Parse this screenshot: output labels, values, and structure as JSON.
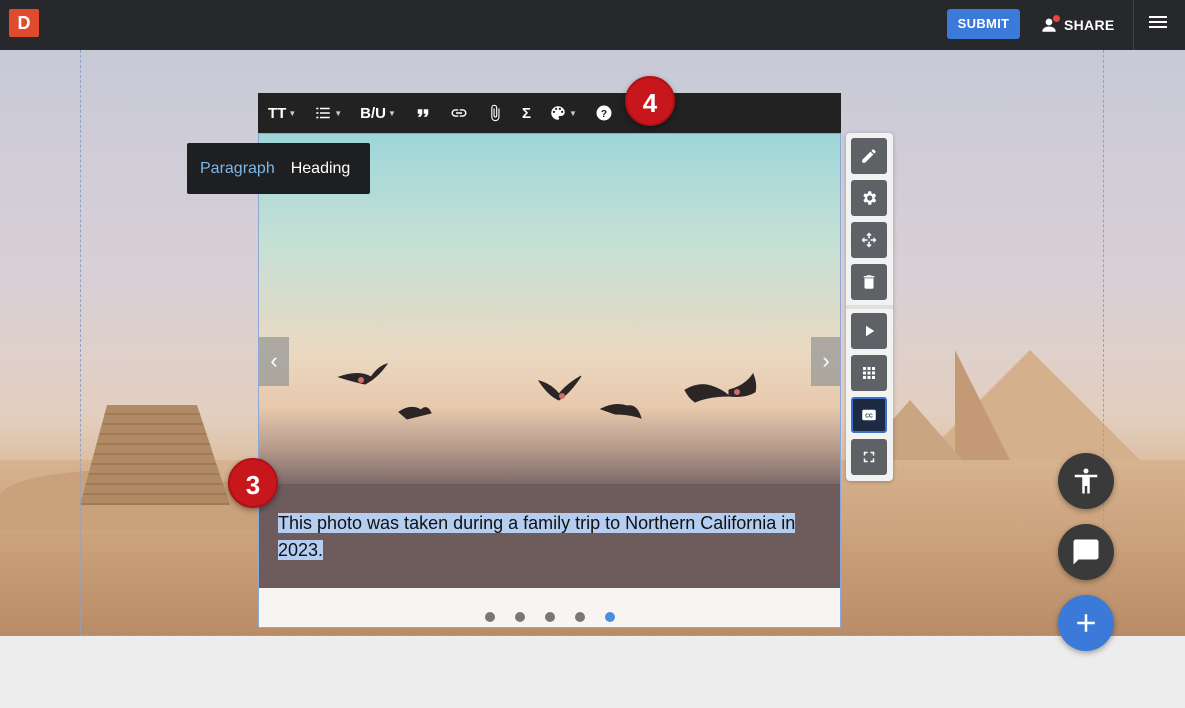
{
  "app": {
    "logo_letter": "D"
  },
  "header": {
    "submit_label": "SUBMIT",
    "share_label": "SHARE"
  },
  "toolbar": {
    "items": [
      {
        "label": "TT",
        "icon": "text-size-icon"
      },
      {
        "icon": "list-icon"
      },
      {
        "label": "B/U",
        "icon": "bold-underline-icon"
      },
      {
        "icon": "quote-icon"
      },
      {
        "icon": "link-icon"
      },
      {
        "icon": "attachment-icon"
      },
      {
        "label": "Σ",
        "icon": "math-icon"
      },
      {
        "icon": "palette-icon"
      },
      {
        "icon": "help-icon"
      }
    ]
  },
  "text_style_popover": {
    "paragraph": "Paragraph",
    "heading": "Heading"
  },
  "step_badges": {
    "top": "4",
    "caption": "3"
  },
  "slideshow": {
    "caption": "This photo was taken during a family trip to Northern California in 2023.",
    "slide_count": 5,
    "active_slide": 5,
    "prev_arrow": "‹",
    "next_arrow": "›"
  },
  "side_tools": [
    "edit-icon",
    "settings-icon",
    "move-icon",
    "delete-icon",
    "play-icon",
    "grid-icon",
    "closed-captions-icon",
    "fullscreen-icon"
  ],
  "colors": {
    "brand": "#e04a2e",
    "accent": "#3b7ad9",
    "badge": "#c8161d",
    "fab_blue": "#3b7ad9",
    "fab_dark": "#3a3a3a"
  }
}
